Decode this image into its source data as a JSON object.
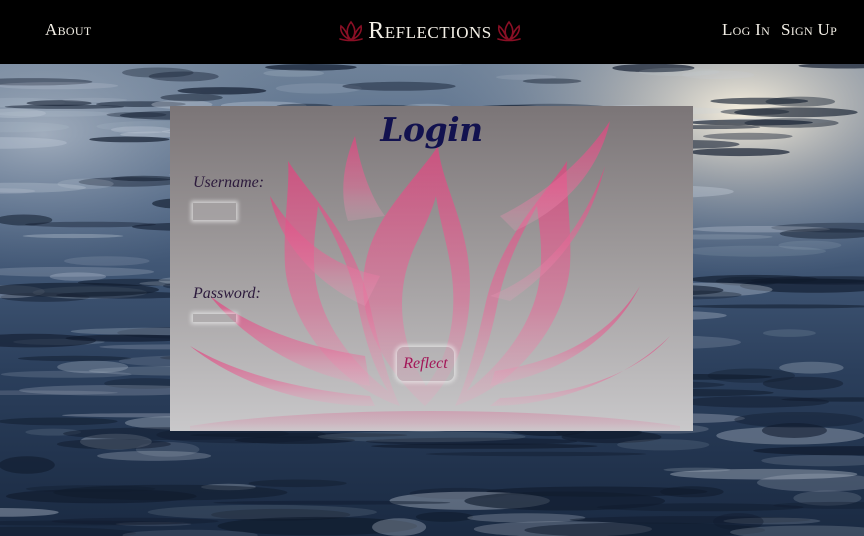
{
  "nav": {
    "about_label": "About",
    "login_label": "Log In",
    "signup_label": "Sign Up"
  },
  "brand": {
    "title": "Reflections",
    "icon": "lotus-icon"
  },
  "login_form": {
    "title": "Login",
    "username_label": "Username:",
    "username_value": "",
    "password_label": "Password:",
    "password_value": "",
    "submit_label": "Reflect"
  },
  "colors": {
    "header_bg": "#000000",
    "nav_text": "#f3efe6",
    "title_color": "#12124f",
    "label_color": "#2c1a3c",
    "button_text": "#a31658",
    "lotus_pink": "#d7417a"
  }
}
